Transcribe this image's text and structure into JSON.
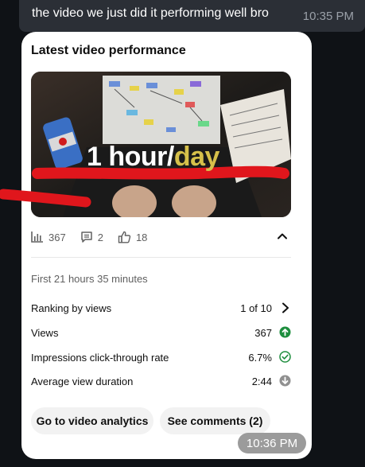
{
  "message": {
    "text": "the video we just did it performing well bro",
    "time": "10:35 PM"
  },
  "card": {
    "title": "Latest video performance",
    "thumbnail": {
      "overlay_main": "1 hour/",
      "overlay_accent": "day"
    },
    "metrics": {
      "views": "367",
      "comments": "2",
      "likes": "18"
    },
    "period": "First 21 hours 35 minutes",
    "stats": [
      {
        "label": "Ranking by views",
        "value": "1 of 10",
        "icon": "chevron-right-icon"
      },
      {
        "label": "Views",
        "value": "367",
        "icon": "arrow-up-circle-icon"
      },
      {
        "label": "Impressions click-through rate",
        "value": "6.7%",
        "icon": "check-circle-icon"
      },
      {
        "label": "Average view duration",
        "value": "2:44",
        "icon": "arrow-down-circle-icon"
      }
    ],
    "buttons": {
      "analytics": "Go to video analytics",
      "comments": "See comments (2)"
    }
  },
  "footer": {
    "time": "10:36 PM"
  },
  "colors": {
    "card_bg": "#ffffff",
    "up_green": "#1e8e3e",
    "muted_gray": "#909090",
    "scribble_red": "#e0161c"
  }
}
